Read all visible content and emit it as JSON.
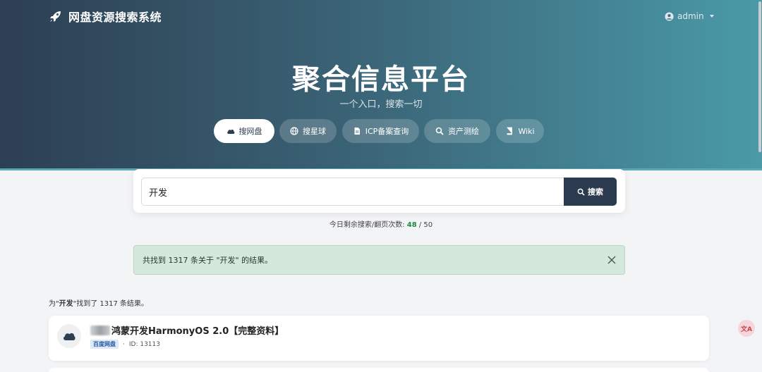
{
  "navbar": {
    "brand": "网盘资源搜索系统",
    "user": "admin"
  },
  "hero": {
    "title": "聚合信息平台",
    "subtitle": "一个入口，搜索一切"
  },
  "tabs": [
    {
      "label": "搜网盘",
      "icon": "cloud-icon",
      "active": true
    },
    {
      "label": "搜星球",
      "icon": "globe-icon",
      "active": false
    },
    {
      "label": "ICP备案查询",
      "icon": "file-icon",
      "active": false
    },
    {
      "label": "资产测绘",
      "icon": "search-icon",
      "active": false
    },
    {
      "label": "Wiki",
      "icon": "book-icon",
      "active": false
    }
  ],
  "search": {
    "value": "开发",
    "button_label": "搜索"
  },
  "quota": {
    "label": "今日剩余搜索/翻页次数:",
    "used": "48",
    "sep": " / ",
    "total": "50"
  },
  "alert": {
    "message": "共找到 1317 条关于 \"开发\" 的结果。"
  },
  "summary": {
    "prefix": "为\"",
    "keyword": "开发",
    "suffix": "\"找到了 1317 条结果。"
  },
  "results": [
    {
      "title": "鸿蒙开发HarmonyOS 2.0【完整资料】",
      "badge": "百度网盘",
      "id_text": "ID: 13113",
      "dot": "·"
    }
  ],
  "float_button": "文A",
  "colors": {
    "hero_start": "#2d3f52",
    "hero_end": "#4a9aa8",
    "button_dark": "#2b3a4e",
    "alert_bg": "#d4e8dc",
    "quota_green": "#1e8a3c"
  }
}
